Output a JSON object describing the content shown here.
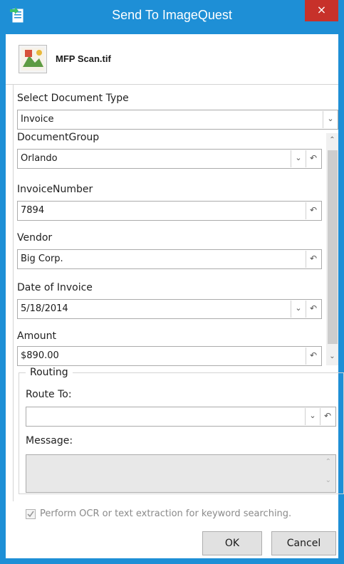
{
  "window": {
    "title": "Send To ImageQuest",
    "close_label": "×",
    "accent_color": "#1e8fd6"
  },
  "file": {
    "name": "MFP Scan.tif",
    "icon": "document-image-icon"
  },
  "document_type": {
    "label": "Select Document Type",
    "value": "Invoice"
  },
  "fields": [
    {
      "label": "DocumentGroup",
      "value": "Orlando",
      "has_dropdown": true
    },
    {
      "label": "InvoiceNumber",
      "value": "7894",
      "has_dropdown": false
    },
    {
      "label": "Vendor",
      "value": "Big Corp.",
      "has_dropdown": false
    },
    {
      "label": "Date of Invoice",
      "value": "5/18/2014",
      "has_dropdown": true
    },
    {
      "label": "Amount",
      "value": "$890.00",
      "has_dropdown": false
    }
  ],
  "routing": {
    "legend": "Routing",
    "route_to_label": "Route To:",
    "route_to_value": "",
    "message_label": "Message:",
    "message_value": ""
  },
  "ocr": {
    "label": "Perform OCR or text extraction for keyword searching.",
    "checked": true,
    "enabled": false
  },
  "buttons": {
    "ok": "OK",
    "cancel": "Cancel"
  },
  "icons": {
    "dropdown": "chevron-down-icon",
    "undo": "undo-icon",
    "scroll_up": "chevron-up-icon",
    "scroll_down": "chevron-down-icon"
  }
}
